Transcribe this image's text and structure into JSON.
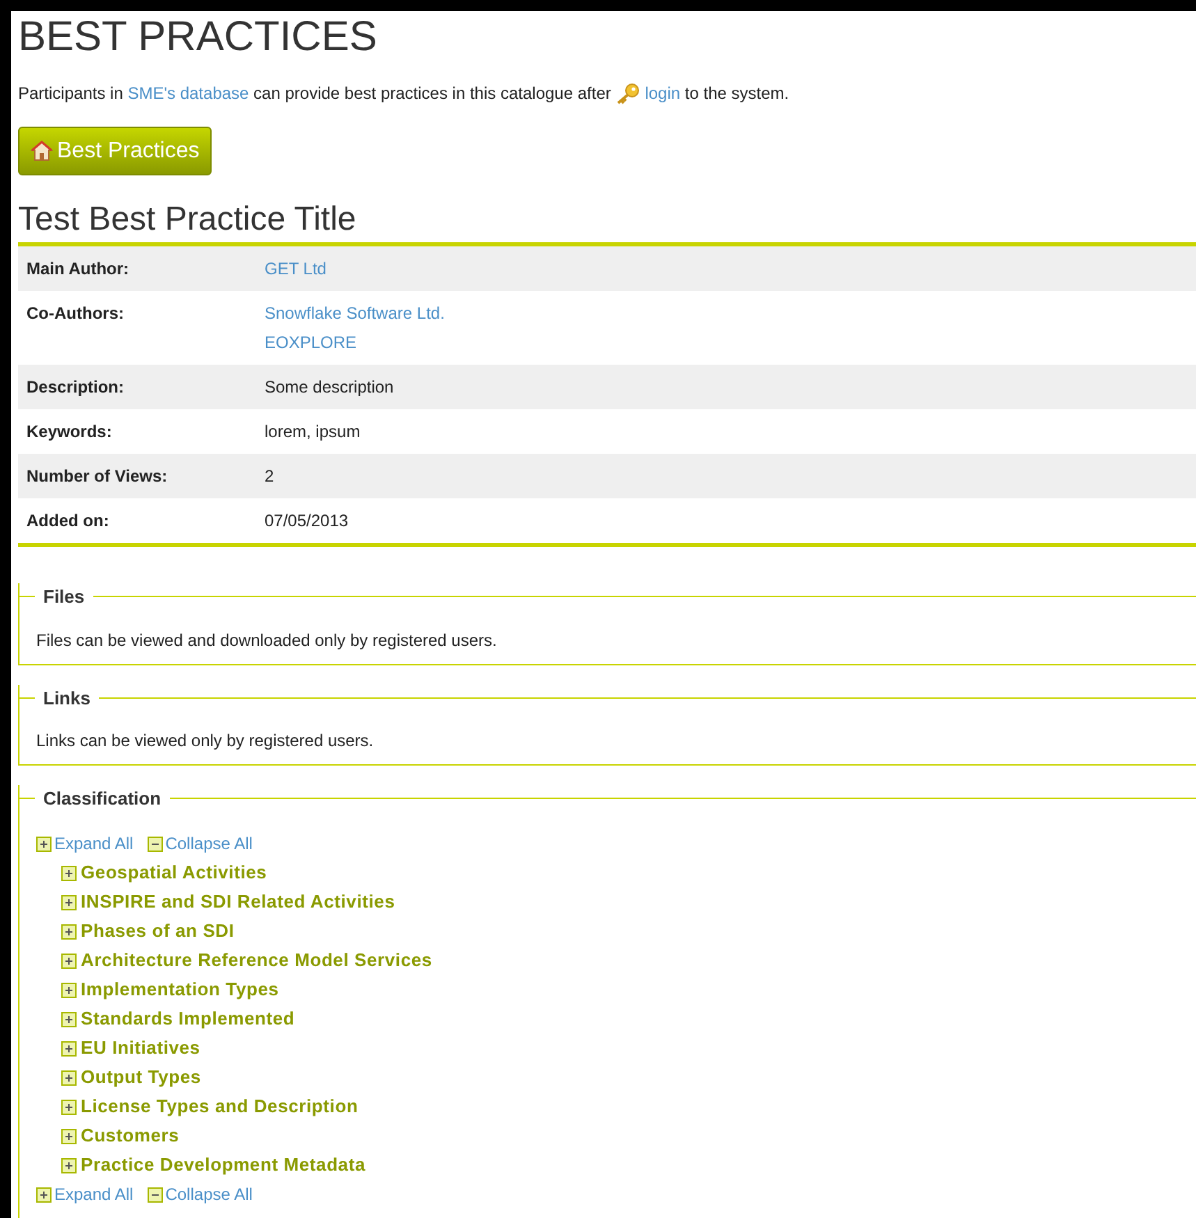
{
  "title": "BEST PRACTICES",
  "intro": {
    "before": "Participants in ",
    "link1": "SME's database",
    "middle": " can provide best practices in this catalogue after ",
    "link2": "login",
    "after": " to the system."
  },
  "home_button": "Best Practices",
  "practice_title": "Test Best Practice Title",
  "details": [
    {
      "label": "Main Author:",
      "values": [
        "GET Ltd"
      ],
      "kind": "link"
    },
    {
      "label": "Co-Authors:",
      "values": [
        "Snowflake Software Ltd.",
        "EOXPLORE"
      ],
      "kind": "link"
    },
    {
      "label": "Description:",
      "values": [
        "Some description"
      ],
      "kind": "text"
    },
    {
      "label": "Keywords:",
      "values": [
        "lorem, ipsum"
      ],
      "kind": "text"
    },
    {
      "label": "Number of Views:",
      "values": [
        "2"
      ],
      "kind": "text"
    },
    {
      "label": "Added on:",
      "values": [
        "07/05/2013"
      ],
      "kind": "text"
    }
  ],
  "sections": [
    {
      "legend": "Files",
      "text": "Files can be viewed and downloaded only by registered users."
    },
    {
      "legend": "Links",
      "text": "Links can be viewed only by registered users."
    }
  ],
  "classification": {
    "legend": "Classification",
    "expand_all": "Expand All",
    "collapse_all": "Collapse All",
    "items": [
      {
        "label": "Geospatial Activities",
        "expanded": false
      },
      {
        "label": "INSPIRE and SDI Related Activities",
        "expanded": false
      },
      {
        "label": "Phases of an SDI",
        "expanded": false
      },
      {
        "label": "Architecture Reference Model Services",
        "expanded": false
      },
      {
        "label": "Implementation Types",
        "expanded": false
      },
      {
        "label": "Standards Implemented",
        "expanded": false
      },
      {
        "label": "EU Initiatives",
        "expanded": false
      },
      {
        "label": "Output Types",
        "expanded": false
      },
      {
        "label": "License Types and Description",
        "expanded": false
      },
      {
        "label": "Customers",
        "expanded": false
      },
      {
        "label": "Practice Development Metadata",
        "expanded": false
      }
    ],
    "expand_all_bottom": "Expand All",
    "collapse_all_bottom": "Collapse All"
  }
}
